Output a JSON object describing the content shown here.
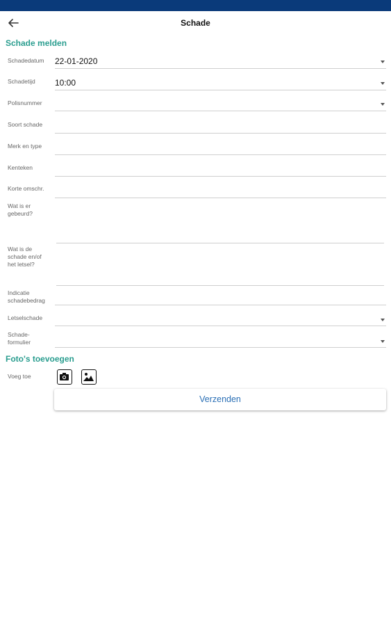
{
  "header": {
    "title": "Schade"
  },
  "sections": {
    "report": "Schade melden",
    "photos": "Foto's toevoegen"
  },
  "fields": {
    "date": {
      "label": "Schadedatum",
      "value": "22-01-2020"
    },
    "time": {
      "label": "Schadetijd",
      "value": "10:00"
    },
    "policy": {
      "label": "Polisnummer",
      "value": ""
    },
    "type": {
      "label": "Soort schade",
      "value": ""
    },
    "brand": {
      "label": "Merk en type",
      "value": ""
    },
    "plate": {
      "label": "Kenteken",
      "value": ""
    },
    "short": {
      "label": "Korte omschr.",
      "value": ""
    },
    "what": {
      "label": "Wat is er gebeurd?",
      "value": ""
    },
    "damage": {
      "label": "Wat is de schade en/of het letsel?",
      "value": ""
    },
    "amount": {
      "label": "Indicatie schadebedrag",
      "value": ""
    },
    "injury": {
      "label": "Letselschade",
      "value": ""
    },
    "form": {
      "label": "Schade-formulier",
      "value": ""
    }
  },
  "photos": {
    "label": "Voeg toe"
  },
  "submit": {
    "label": "Verzenden"
  },
  "colors": {
    "statusbar": "#0a3a7a",
    "accent": "#2a9d8f",
    "button_text": "#2a6fb5"
  }
}
